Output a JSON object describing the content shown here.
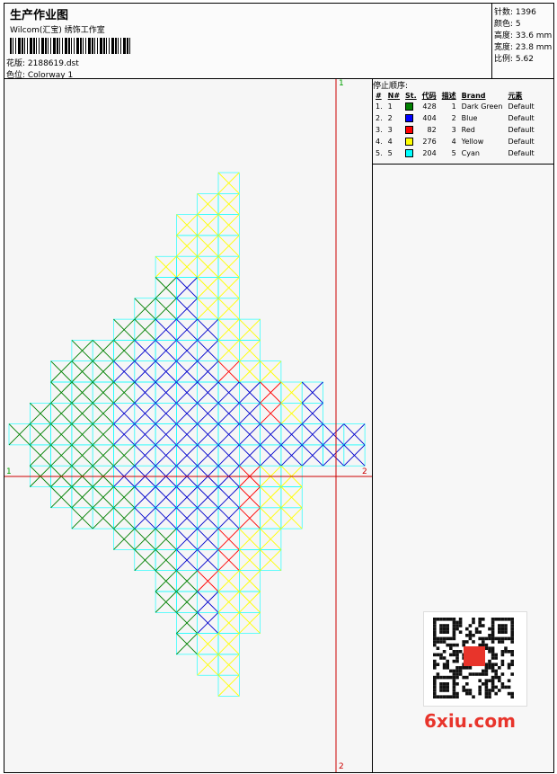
{
  "header": {
    "title": "生产作业图",
    "company": "Wilcom(汇宝) 绣饰工作室",
    "design_label": "花版: 2188619.dst",
    "colorway_label": "色位: Colorway 1"
  },
  "stats": {
    "stitches": "针数: 1396",
    "colors": "颜色: 5",
    "height": "高度: 33.6 mm",
    "width": "宽度: 23.8 mm",
    "scale": "比例: 5.62"
  },
  "stop_sequence": {
    "title": "停止顺序:",
    "columns": [
      "#",
      "N#",
      "St.",
      "代码",
      "描述",
      "Brand",
      "元素"
    ],
    "rows": [
      {
        "index": "1.",
        "n": "1",
        "st": "428",
        "code": "1",
        "desc": "Dark Green",
        "brand": "Default",
        "color": "#008000"
      },
      {
        "index": "2.",
        "n": "2",
        "st": "404",
        "code": "2",
        "desc": "Blue",
        "brand": "Default",
        "color": "#0000ff"
      },
      {
        "index": "3.",
        "n": "3",
        "st": "82",
        "code": "3",
        "desc": "Red",
        "brand": "Default",
        "color": "#ff0000"
      },
      {
        "index": "4.",
        "n": "4",
        "st": "276",
        "code": "4",
        "desc": "Yellow",
        "brand": "Default",
        "color": "#ffff00"
      },
      {
        "index": "5.",
        "n": "5",
        "st": "204",
        "code": "5",
        "desc": "Cyan",
        "brand": "Default",
        "color": "#00ffff"
      }
    ]
  },
  "axes": {
    "v_top": "1",
    "v_bottom": "2",
    "h_left": "1",
    "h_right": "2"
  },
  "watermark": "6xiu.com",
  "colors": {
    "green": "#008000",
    "blue": "#0000cc",
    "red": "#ff0000",
    "yellow": "#ffff00",
    "cyan": "#00ffff",
    "axis": "#cc0000"
  }
}
